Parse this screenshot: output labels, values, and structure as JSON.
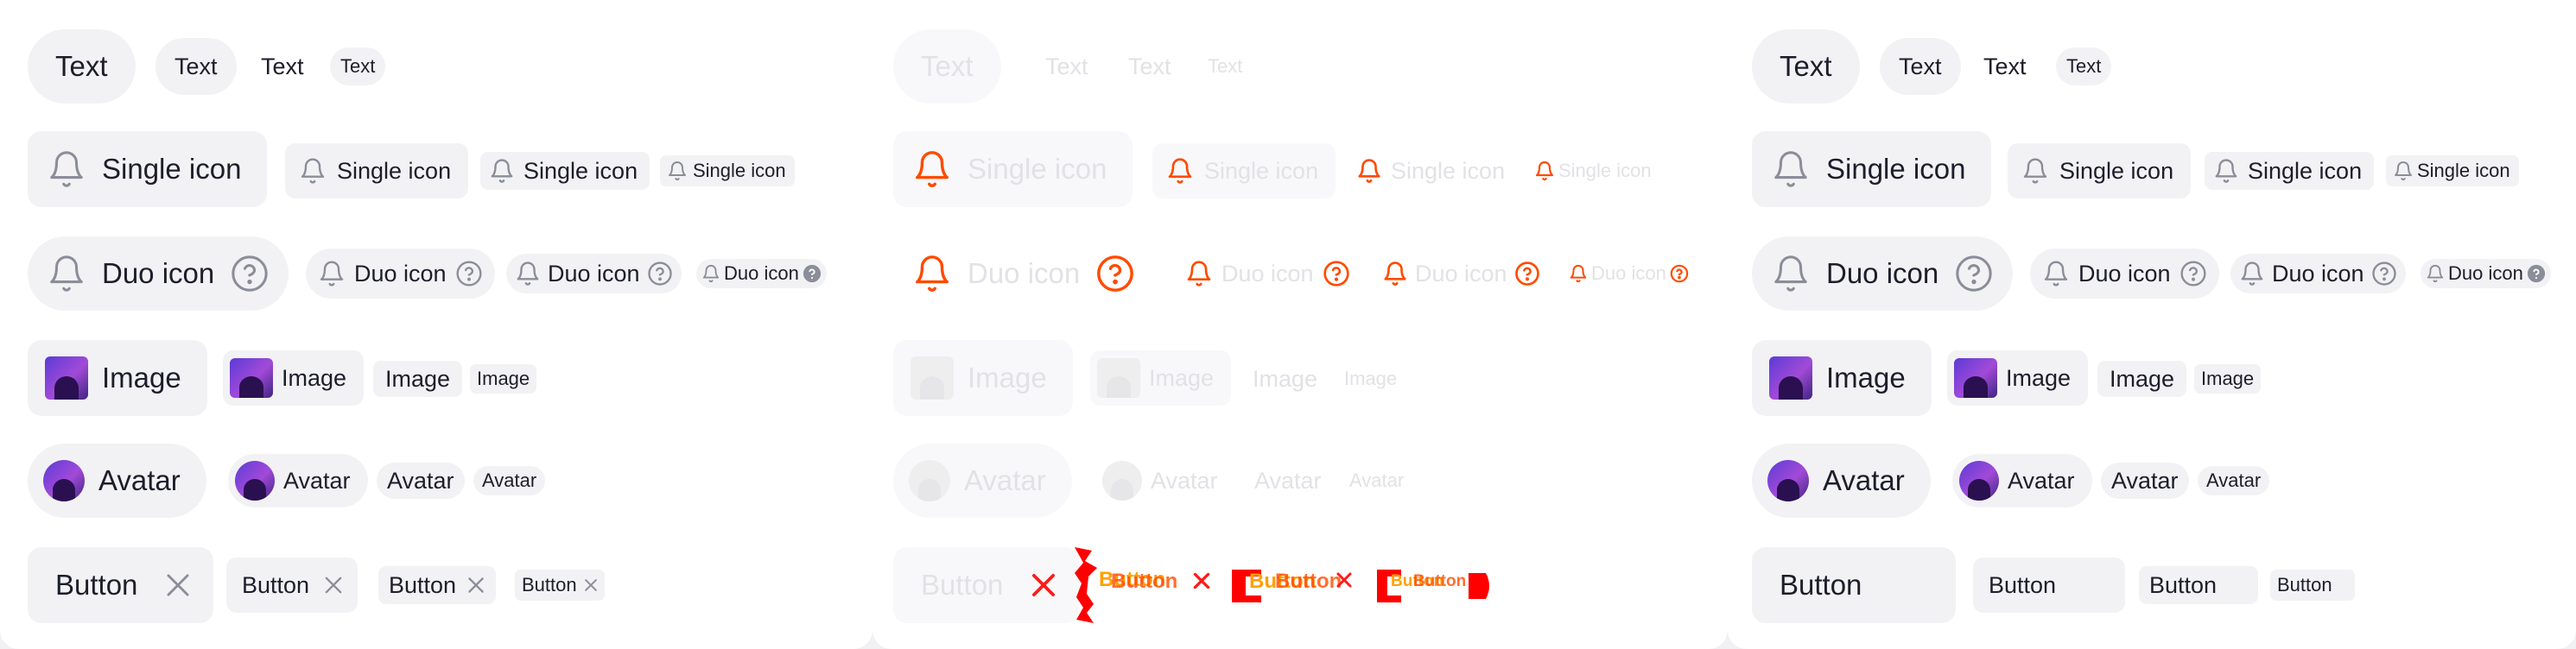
{
  "colors": {
    "panel": "#ffffff",
    "chip_bg": "#f2f2f5",
    "icon_gray": "#8b8d98",
    "text": "#1d1e2a",
    "disabled_text": "#e2e2e6",
    "error_orange": "#ff4a00",
    "error_red": "#ff0000"
  },
  "labels": {
    "text": "Text",
    "single_icon": "Single icon",
    "duo_icon": "Duo icon",
    "image": "Image",
    "avatar": "Avatar",
    "button": "Button"
  },
  "icons": {
    "leading": "bell-icon",
    "trailing_duo": "help-circle-icon",
    "close": "close-icon"
  },
  "glitch_text": "Button"
}
